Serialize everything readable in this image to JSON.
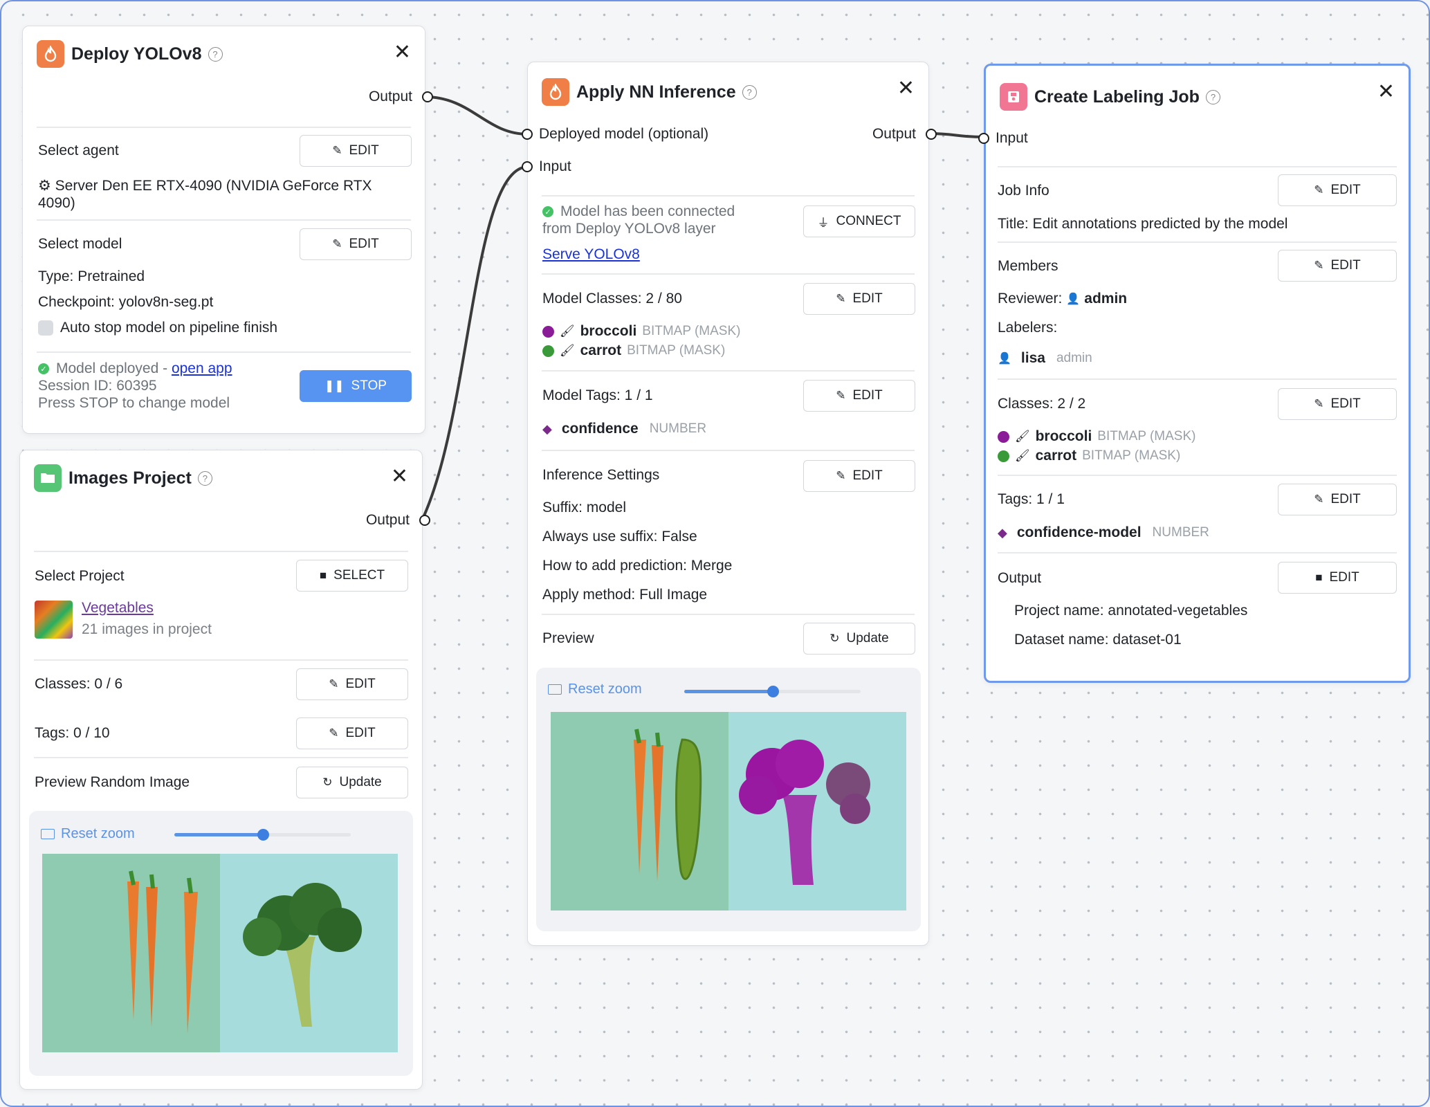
{
  "colors": {
    "accent_blue": "#5793f0",
    "canvas_border": "#6f93e3",
    "class_broccoli": "#8a1c98",
    "class_carrot": "#3a9a3a",
    "tag_purple": "#7b2a8c"
  },
  "deploy": {
    "title": "Deploy YOLOv8",
    "output_label": "Output",
    "agent_label": "Select agent",
    "edit_label": "EDIT",
    "agent_value": "Server Den EE RTX-4090 (NVIDIA GeForce RTX 4090)",
    "model_label": "Select model",
    "type": "Type: Pretrained",
    "checkpoint": "Checkpoint: yolov8n-seg.pt",
    "auto_stop": "Auto stop model on pipeline finish",
    "status_prefix": "Model deployed - ",
    "open_app": "open app",
    "session": "Session ID: 60395",
    "hint": "Press STOP to change model",
    "stop_label": "STOP"
  },
  "images_project": {
    "title": "Images Project",
    "output_label": "Output",
    "select_project_label": "Select Project",
    "select_btn": "SELECT",
    "project_name": "Vegetables",
    "project_count": "21 images in project",
    "classes": "Classes: 0 / 6",
    "tags": "Tags: 0 / 10",
    "edit_label": "EDIT",
    "preview_label": "Preview Random Image",
    "update_btn": "Update",
    "reset_zoom": "Reset zoom",
    "zoom_level": 0.5
  },
  "inference": {
    "title": "Apply NN Inference",
    "in_model": "Deployed model (optional)",
    "in_input": "Input",
    "output_label": "Output",
    "connected_msg_1": "Model has been connected",
    "connected_msg_2": "from Deploy YOLOv8 layer",
    "connect_btn": "CONNECT",
    "serve_link": "Serve YOLOv8",
    "model_classes": "Model Classes: 2 / 80",
    "edit_label": "EDIT",
    "classes": [
      {
        "name": "broccoli",
        "shape": "BITMAP (MASK)",
        "color": "#8a1c98"
      },
      {
        "name": "carrot",
        "shape": "BITMAP (MASK)",
        "color": "#3a9a3a"
      }
    ],
    "model_tags": "Model Tags: 1 / 1",
    "tag_name": "confidence",
    "tag_type": "NUMBER",
    "settings_label": "Inference Settings",
    "settings": [
      "Suffix: model",
      "Always use suffix: False",
      "How to add prediction: Merge",
      "Apply method: Full Image"
    ],
    "preview_label": "Preview",
    "update_btn": "Update",
    "reset_zoom": "Reset zoom",
    "zoom_level": 0.5
  },
  "labeling": {
    "title": "Create Labeling Job",
    "input_label": "Input",
    "job_info": "Job Info",
    "edit_label": "EDIT",
    "job_title": "Title: Edit annotations predicted by the model",
    "members": "Members",
    "reviewer_label": "Reviewer:",
    "reviewer": "admin",
    "labelers_label": "Labelers:",
    "labeler_name": "lisa",
    "labeler_role": "admin",
    "classes_label": "Classes: 2 / 2",
    "classes": [
      {
        "name": "broccoli",
        "shape": "BITMAP (MASK)",
        "color": "#8a1c98"
      },
      {
        "name": "carrot",
        "shape": "BITMAP (MASK)",
        "color": "#3a9a3a"
      }
    ],
    "tags_label": "Tags: 1 / 1",
    "tag_name": "confidence-model",
    "tag_type": "NUMBER",
    "output_label": "Output",
    "project_name": "Project name: annotated-vegetables",
    "dataset_name": "Dataset name: dataset-01"
  },
  "icons": {
    "node_flame": "flame-icon",
    "node_folder": "folder-icon",
    "node_save": "save-icon",
    "edit": "pencil-icon",
    "close": "close-icon",
    "help": "help-icon",
    "connect": "plug-icon",
    "refresh": "refresh-icon",
    "user": "user-icon",
    "tag": "tag-icon"
  }
}
